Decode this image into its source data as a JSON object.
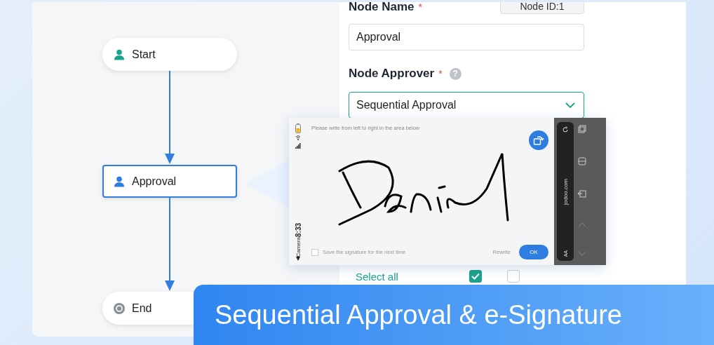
{
  "flow": {
    "nodes": [
      {
        "label": "Start",
        "kind": "start",
        "selected": false
      },
      {
        "label": "Approval",
        "kind": "approver",
        "selected": true
      },
      {
        "label": "End",
        "kind": "end",
        "selected": false
      }
    ]
  },
  "form": {
    "node_name": {
      "label": "Node Name",
      "required_mark": "*"
    },
    "node_id": "Node ID:1",
    "node_name_value": "Approval",
    "approver": {
      "label": "Node Approver",
      "required_mark": "*",
      "help_glyph": "?"
    },
    "approver_value": "Sequential Approval",
    "select_all": {
      "label": "Select all",
      "checks": [
        {
          "checked": true
        },
        {
          "checked": false
        }
      ]
    }
  },
  "signature_pad": {
    "prompt": "Please write from left to right in the area below",
    "time": "8:33",
    "back_label": "Camera",
    "save_option": {
      "label": "Save the signature for the next time",
      "checked": false
    },
    "rewrite": "Rewrite",
    "ok": "OK",
    "url": "jodoo.com",
    "text_size": "AA"
  },
  "banner": {
    "title": "Sequential Approval & e-Signature"
  }
}
